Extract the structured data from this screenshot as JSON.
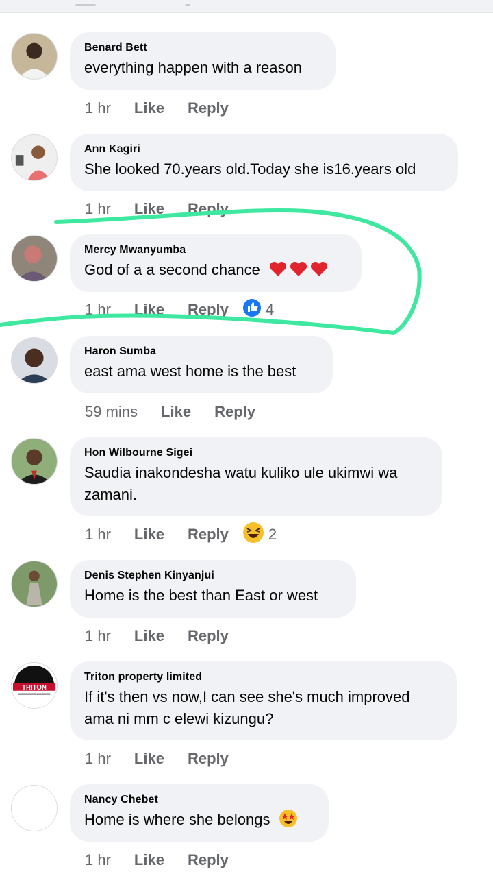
{
  "comments": [
    {
      "author": "Benard Bett",
      "text": "everything happen with a reason",
      "time": "1 hr",
      "like": "Like",
      "reply": "Reply"
    },
    {
      "author": "Ann Kagiri",
      "text": "She looked 70.years old.Today she is16.years old",
      "time": "1 hr",
      "like": "Like",
      "reply": "Reply"
    },
    {
      "author": "Mercy Mwanyumba",
      "text": "God of a a second chance",
      "time": "1 hr",
      "like": "Like",
      "reply": "Reply",
      "reaction_count": "4",
      "reaction_icon": "thumbs-up-icon",
      "emojis": "heart-emoji x3"
    },
    {
      "author": "Haron Sumba",
      "text": "east ama west home is the best",
      "time": "59 mins",
      "like": "Like",
      "reply": "Reply"
    },
    {
      "author": "Hon Wilbourne Sigei",
      "text_line1": "Saudia inakondesha watu kuliko ule ukimwi wa",
      "text_line2": "zamani.",
      "time": "1 hr",
      "like": "Like",
      "reply": "Reply",
      "reaction_count": "2",
      "reaction_icon": "laughing-emoji-icon"
    },
    {
      "author": "Denis Stephen Kinyanjui",
      "text": "Home is the best than East or west",
      "time": "1 hr",
      "like": "Like",
      "reply": "Reply"
    },
    {
      "author": "Triton property limited",
      "text_line1": "If it's then vs now,I can see she's much improved",
      "text_line2": "ama ni mm c elewi kizungu?",
      "time": "1 hr",
      "like": "Like",
      "reply": "Reply",
      "avatar_logo": "TRITON"
    },
    {
      "author": "Nancy Chebet",
      "text": "Home is where she belongs",
      "time": "1 hr",
      "like": "Like",
      "reply": "Reply",
      "emojis": "star-struck-emoji"
    }
  ],
  "colors": {
    "bubble": "#f0f2f5",
    "meta": "#65676b",
    "like_blue": "#1877f2",
    "highlight": "#3ee8a0",
    "heart": "#e0252c"
  }
}
